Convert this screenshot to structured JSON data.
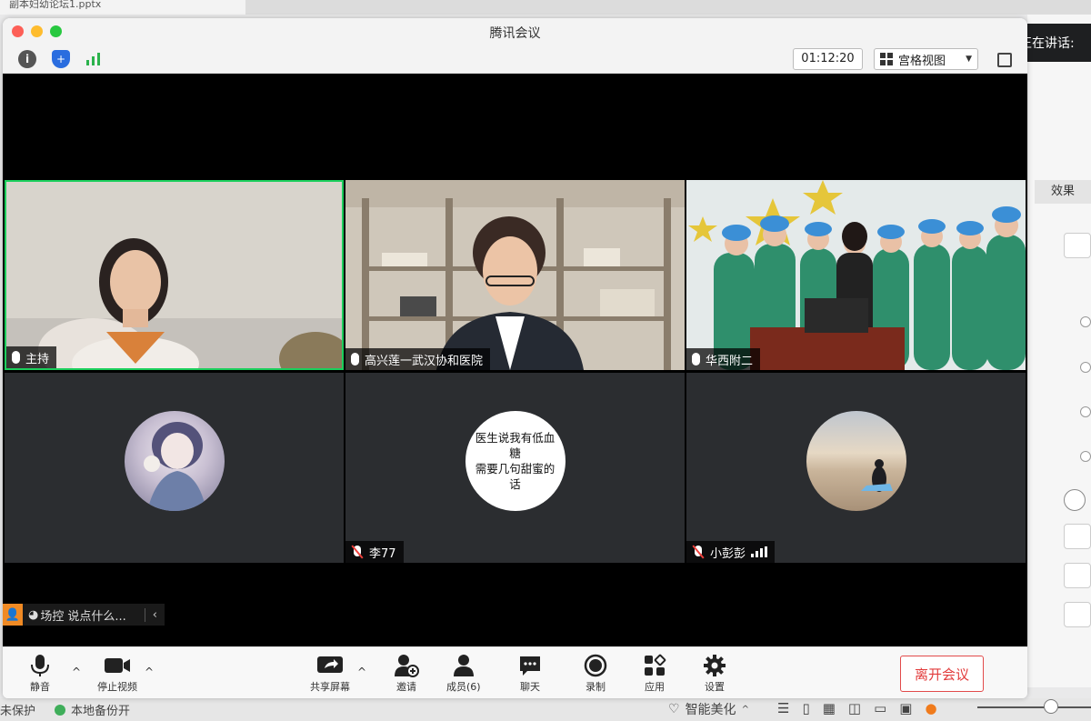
{
  "background": {
    "tab_title": "副本妇幼论坛1.pptx",
    "right_pane_label": "效果",
    "status_left": "未保护",
    "status_backup": "本地备份开",
    "beauty_label": "智能美化",
    "beauty_caret": "^"
  },
  "speaking": {
    "label": "正在讲话:"
  },
  "window": {
    "title": "腾讯会议",
    "timer": "01:12:20",
    "view_mode": "宫格视图",
    "info_glyph": "i"
  },
  "participants": [
    {
      "name": "主持",
      "mic": "on"
    },
    {
      "name": "高兴莲一武汉协和医院",
      "mic": "on"
    },
    {
      "name": "华西附二",
      "mic": "on"
    },
    {
      "name": "",
      "mic": "none"
    },
    {
      "name": "李77",
      "mic": "muted"
    },
    {
      "name": "小彭彭",
      "mic": "muted",
      "signal": true
    }
  ],
  "avatar_text_line1": "医生说我有低血糖",
  "avatar_text_line2": "需要几句甜蜜的话",
  "chat": {
    "placeholder": "说点什么...",
    "sender": "场控",
    "collapse": "‹"
  },
  "controls": {
    "mute": "静音",
    "stop_video": "停止视频",
    "share_screen": "共享屏幕",
    "invite": "邀请",
    "members": "成员(6)",
    "chat": "聊天",
    "record": "录制",
    "apps": "应用",
    "settings": "设置",
    "leave": "离开会议",
    "caret": "^"
  },
  "colors": {
    "active_speaker_border": "#1ccf5c",
    "leave_red": "#e23b3b",
    "shield_blue": "#2a6ddf",
    "signal_green": "#2bb24c"
  }
}
